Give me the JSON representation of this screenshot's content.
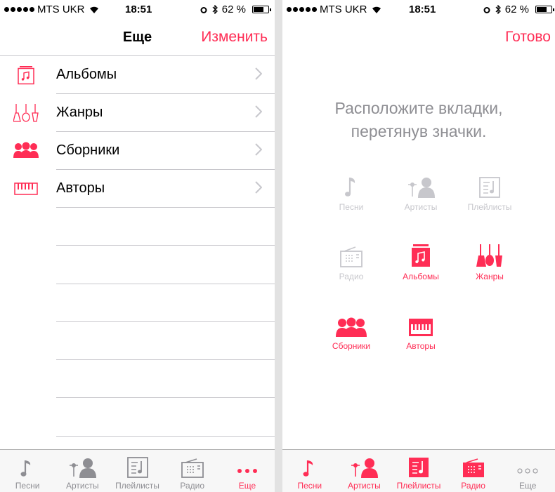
{
  "colors": {
    "accent": "#ff2d55",
    "inactive": "#8e8e93",
    "disabled": "#c7c7cc"
  },
  "left": {
    "status": {
      "carrier": "MTS UKR",
      "time": "18:51",
      "battery": "62 %"
    },
    "nav": {
      "title": "Еще",
      "action": "Изменить"
    },
    "list": [
      {
        "label": "Альбомы",
        "icon": "album-icon"
      },
      {
        "label": "Жанры",
        "icon": "genres-guitar-icon"
      },
      {
        "label": "Сборники",
        "icon": "compilations-people-icon"
      },
      {
        "label": "Авторы",
        "icon": "composers-piano-icon"
      }
    ],
    "tabs": [
      {
        "label": "Песни",
        "icon": "music-note-icon"
      },
      {
        "label": "Артисты",
        "icon": "artist-microphone-icon"
      },
      {
        "label": "Плейлисты",
        "icon": "playlist-icon"
      },
      {
        "label": "Радио",
        "icon": "radio-icon"
      },
      {
        "label": "Еще",
        "icon": "more-dots-icon",
        "active": true
      }
    ]
  },
  "right": {
    "status": {
      "carrier": "MTS UKR",
      "time": "18:51",
      "battery": "62 %"
    },
    "nav": {
      "action": "Готово"
    },
    "instruction": [
      "Расположите вкладки,",
      "перетянув значки."
    ],
    "items": [
      {
        "label": "Песни",
        "icon": "music-note-icon",
        "state": "disabled"
      },
      {
        "label": "Артисты",
        "icon": "artist-microphone-icon",
        "state": "disabled"
      },
      {
        "label": "Плейлисты",
        "icon": "playlist-icon",
        "state": "disabled"
      },
      {
        "label": "Радио",
        "icon": "radio-icon",
        "state": "disabled"
      },
      {
        "label": "Альбомы",
        "icon": "album-icon",
        "state": "enabled"
      },
      {
        "label": "Жанры",
        "icon": "genres-guitar-icon",
        "state": "enabled"
      },
      {
        "label": "Сборники",
        "icon": "compilations-people-icon",
        "state": "enabled"
      },
      {
        "label": "Авторы",
        "icon": "composers-piano-icon",
        "state": "enabled"
      }
    ],
    "tabs": [
      {
        "label": "Песни",
        "icon": "music-note-icon"
      },
      {
        "label": "Артисты",
        "icon": "artist-microphone-icon"
      },
      {
        "label": "Плейлисты",
        "icon": "playlist-icon"
      },
      {
        "label": "Радио",
        "icon": "radio-icon"
      },
      {
        "label": "Еще",
        "icon": "more-dots-icon"
      }
    ]
  }
}
